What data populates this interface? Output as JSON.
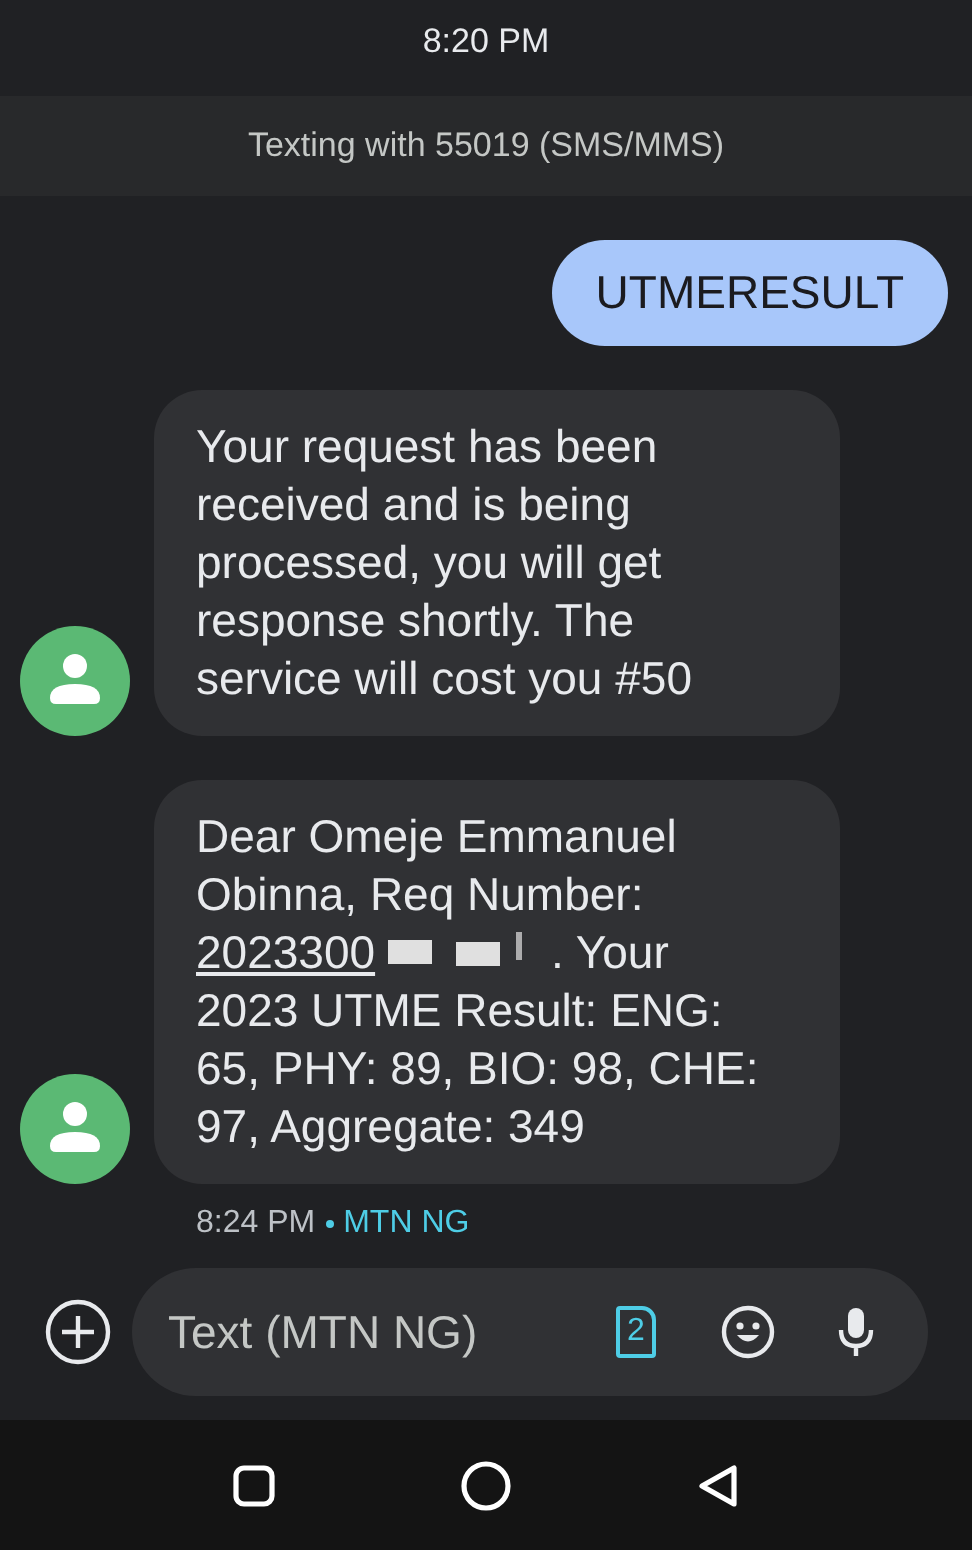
{
  "status_bar": {
    "time": "8:20 PM"
  },
  "header": {
    "title": "Texting with 55019 (SMS/MMS)"
  },
  "messages": [
    {
      "kind": "sent",
      "segments": [
        {
          "kind": "text",
          "text": "UTMERESULT"
        }
      ]
    },
    {
      "kind": "received",
      "segments": [
        {
          "kind": "text",
          "text": "Your request has been received and is being processed, you will get response shortly. The service will cost you #50"
        }
      ]
    },
    {
      "kind": "received",
      "segments": [
        {
          "kind": "text",
          "text": "Dear Omeje Emmanuel Obinna, Req Number: "
        },
        {
          "kind": "link",
          "text": "2023300"
        },
        {
          "kind": "redacted"
        },
        {
          "kind": "text",
          "text": ". Your 2023 UTME Result: ENG: 65, PHY: 89, BIO: 98, CHE: 97, Aggregate: 349"
        }
      ],
      "time": "8:24 PM",
      "carrier": "MTN NG"
    }
  ],
  "composer": {
    "placeholder": "Text (MTN NG)",
    "sim": "2"
  }
}
